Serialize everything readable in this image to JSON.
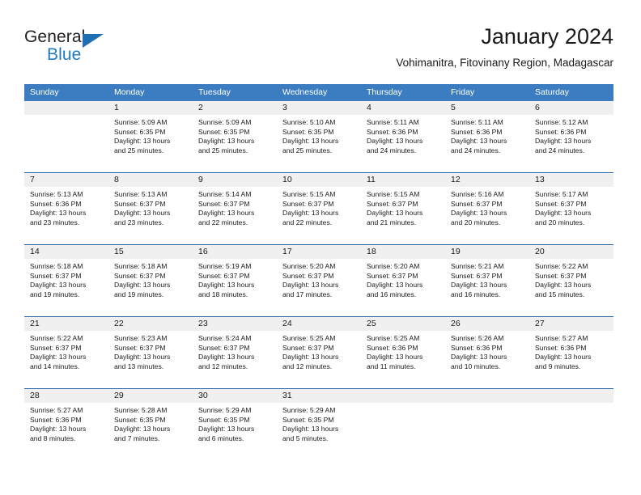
{
  "brand": {
    "name_top": "General",
    "name_bottom": "Blue",
    "logo_icon": "triangle-logo-icon",
    "accent_color": "#1f7ac4"
  },
  "header": {
    "title": "January 2024",
    "subtitle": "Vohimanitra, Fitovinany Region, Madagascar"
  },
  "colors": {
    "header_blue": "#3b7dc0",
    "row_divider_blue": "#2b6ca8",
    "day_band_gray": "#f0f0f0"
  },
  "weekdays": [
    "Sunday",
    "Monday",
    "Tuesday",
    "Wednesday",
    "Thursday",
    "Friday",
    "Saturday"
  ],
  "weeks": [
    [
      {
        "day": "",
        "lines": []
      },
      {
        "day": "1",
        "lines": [
          "Sunrise: 5:09 AM",
          "Sunset: 6:35 PM",
          "Daylight: 13 hours",
          "and 25 minutes."
        ]
      },
      {
        "day": "2",
        "lines": [
          "Sunrise: 5:09 AM",
          "Sunset: 6:35 PM",
          "Daylight: 13 hours",
          "and 25 minutes."
        ]
      },
      {
        "day": "3",
        "lines": [
          "Sunrise: 5:10 AM",
          "Sunset: 6:35 PM",
          "Daylight: 13 hours",
          "and 25 minutes."
        ]
      },
      {
        "day": "4",
        "lines": [
          "Sunrise: 5:11 AM",
          "Sunset: 6:36 PM",
          "Daylight: 13 hours",
          "and 24 minutes."
        ]
      },
      {
        "day": "5",
        "lines": [
          "Sunrise: 5:11 AM",
          "Sunset: 6:36 PM",
          "Daylight: 13 hours",
          "and 24 minutes."
        ]
      },
      {
        "day": "6",
        "lines": [
          "Sunrise: 5:12 AM",
          "Sunset: 6:36 PM",
          "Daylight: 13 hours",
          "and 24 minutes."
        ]
      }
    ],
    [
      {
        "day": "7",
        "lines": [
          "Sunrise: 5:13 AM",
          "Sunset: 6:36 PM",
          "Daylight: 13 hours",
          "and 23 minutes."
        ]
      },
      {
        "day": "8",
        "lines": [
          "Sunrise: 5:13 AM",
          "Sunset: 6:37 PM",
          "Daylight: 13 hours",
          "and 23 minutes."
        ]
      },
      {
        "day": "9",
        "lines": [
          "Sunrise: 5:14 AM",
          "Sunset: 6:37 PM",
          "Daylight: 13 hours",
          "and 22 minutes."
        ]
      },
      {
        "day": "10",
        "lines": [
          "Sunrise: 5:15 AM",
          "Sunset: 6:37 PM",
          "Daylight: 13 hours",
          "and 22 minutes."
        ]
      },
      {
        "day": "11",
        "lines": [
          "Sunrise: 5:15 AM",
          "Sunset: 6:37 PM",
          "Daylight: 13 hours",
          "and 21 minutes."
        ]
      },
      {
        "day": "12",
        "lines": [
          "Sunrise: 5:16 AM",
          "Sunset: 6:37 PM",
          "Daylight: 13 hours",
          "and 20 minutes."
        ]
      },
      {
        "day": "13",
        "lines": [
          "Sunrise: 5:17 AM",
          "Sunset: 6:37 PM",
          "Daylight: 13 hours",
          "and 20 minutes."
        ]
      }
    ],
    [
      {
        "day": "14",
        "lines": [
          "Sunrise: 5:18 AM",
          "Sunset: 6:37 PM",
          "Daylight: 13 hours",
          "and 19 minutes."
        ]
      },
      {
        "day": "15",
        "lines": [
          "Sunrise: 5:18 AM",
          "Sunset: 6:37 PM",
          "Daylight: 13 hours",
          "and 19 minutes."
        ]
      },
      {
        "day": "16",
        "lines": [
          "Sunrise: 5:19 AM",
          "Sunset: 6:37 PM",
          "Daylight: 13 hours",
          "and 18 minutes."
        ]
      },
      {
        "day": "17",
        "lines": [
          "Sunrise: 5:20 AM",
          "Sunset: 6:37 PM",
          "Daylight: 13 hours",
          "and 17 minutes."
        ]
      },
      {
        "day": "18",
        "lines": [
          "Sunrise: 5:20 AM",
          "Sunset: 6:37 PM",
          "Daylight: 13 hours",
          "and 16 minutes."
        ]
      },
      {
        "day": "19",
        "lines": [
          "Sunrise: 5:21 AM",
          "Sunset: 6:37 PM",
          "Daylight: 13 hours",
          "and 16 minutes."
        ]
      },
      {
        "day": "20",
        "lines": [
          "Sunrise: 5:22 AM",
          "Sunset: 6:37 PM",
          "Daylight: 13 hours",
          "and 15 minutes."
        ]
      }
    ],
    [
      {
        "day": "21",
        "lines": [
          "Sunrise: 5:22 AM",
          "Sunset: 6:37 PM",
          "Daylight: 13 hours",
          "and 14 minutes."
        ]
      },
      {
        "day": "22",
        "lines": [
          "Sunrise: 5:23 AM",
          "Sunset: 6:37 PM",
          "Daylight: 13 hours",
          "and 13 minutes."
        ]
      },
      {
        "day": "23",
        "lines": [
          "Sunrise: 5:24 AM",
          "Sunset: 6:37 PM",
          "Daylight: 13 hours",
          "and 12 minutes."
        ]
      },
      {
        "day": "24",
        "lines": [
          "Sunrise: 5:25 AM",
          "Sunset: 6:37 PM",
          "Daylight: 13 hours",
          "and 12 minutes."
        ]
      },
      {
        "day": "25",
        "lines": [
          "Sunrise: 5:25 AM",
          "Sunset: 6:36 PM",
          "Daylight: 13 hours",
          "and 11 minutes."
        ]
      },
      {
        "day": "26",
        "lines": [
          "Sunrise: 5:26 AM",
          "Sunset: 6:36 PM",
          "Daylight: 13 hours",
          "and 10 minutes."
        ]
      },
      {
        "day": "27",
        "lines": [
          "Sunrise: 5:27 AM",
          "Sunset: 6:36 PM",
          "Daylight: 13 hours",
          "and 9 minutes."
        ]
      }
    ],
    [
      {
        "day": "28",
        "lines": [
          "Sunrise: 5:27 AM",
          "Sunset: 6:36 PM",
          "Daylight: 13 hours",
          "and 8 minutes."
        ]
      },
      {
        "day": "29",
        "lines": [
          "Sunrise: 5:28 AM",
          "Sunset: 6:35 PM",
          "Daylight: 13 hours",
          "and 7 minutes."
        ]
      },
      {
        "day": "30",
        "lines": [
          "Sunrise: 5:29 AM",
          "Sunset: 6:35 PM",
          "Daylight: 13 hours",
          "and 6 minutes."
        ]
      },
      {
        "day": "31",
        "lines": [
          "Sunrise: 5:29 AM",
          "Sunset: 6:35 PM",
          "Daylight: 13 hours",
          "and 5 minutes."
        ]
      },
      {
        "day": "",
        "lines": []
      },
      {
        "day": "",
        "lines": []
      },
      {
        "day": "",
        "lines": []
      }
    ]
  ]
}
